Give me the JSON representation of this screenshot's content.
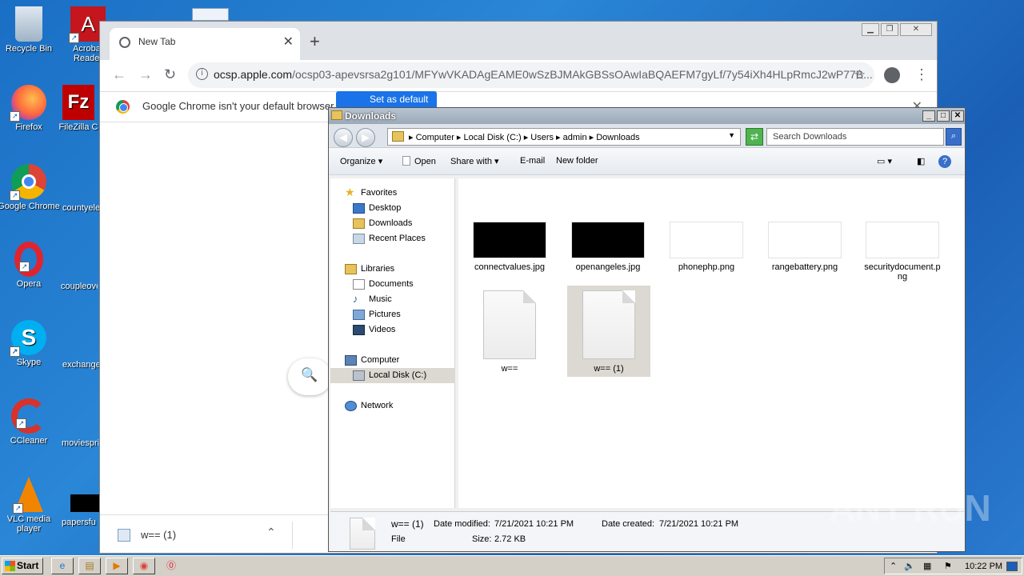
{
  "desktop": {
    "icons": [
      "Recycle Bin",
      "Acrobat Reader",
      "Firefox",
      "FileZilla C",
      "Google Chrome",
      "countyele",
      "Opera",
      "coupleove",
      "Skype",
      "exchange",
      "CCleaner",
      "moviespri",
      "VLC media player",
      "papersfu"
    ]
  },
  "chrome": {
    "tab_title": "New Tab",
    "tab_close": "✕",
    "new_tab": "+",
    "url_host": "ocsp.apple.com",
    "url_path": "/ocsp03-apevsrsa2g101/MFYwVKADAgEAME0wSzBJMAkGBSsOAwIaBQAEFM7gyLf/7y54iXh4HLpRmcJ2wP77B...",
    "infobar_text": "Google Chrome isn't your default browser",
    "set_default": "Set as default",
    "download_name": "w== (1)"
  },
  "explorer": {
    "title": "Downloads",
    "breadcrumb": "▸ Computer ▸ Local Disk (C:) ▸ Users ▸ admin ▸ Downloads",
    "search_placeholder": "Search Downloads",
    "commands": {
      "organize": "Organize",
      "open": "Open",
      "share": "Share with",
      "email": "E-mail",
      "newfolder": "New folder"
    },
    "nav": {
      "favorites": "Favorites",
      "desktop": "Desktop",
      "downloads": "Downloads",
      "recent": "Recent Places",
      "libraries": "Libraries",
      "documents": "Documents",
      "music": "Music",
      "pictures": "Pictures",
      "videos": "Videos",
      "computer": "Computer",
      "localdisk": "Local Disk (C:)",
      "network": "Network"
    },
    "files": [
      "connectvalues.jpg",
      "openangeles.jpg",
      "phonephp.png",
      "rangebattery.png",
      "securitydocument.png",
      "w==",
      "w== (1)"
    ],
    "details": {
      "name": "w== (1)",
      "type": "File",
      "modified_label": "Date modified:",
      "modified": "7/21/2021 10:21 PM",
      "created_label": "Date created:",
      "created": "7/21/2021 10:21 PM",
      "size_label": "Size:",
      "size": "2.72 KB"
    }
  },
  "taskbar": {
    "start": "Start",
    "clock": "10:22 PM"
  },
  "watermark": "ANY RUN",
  "colors": {
    "desktop": "#1a6fc4",
    "chrome_blue": "#1a73e8",
    "selection": "#dcd8d2"
  }
}
